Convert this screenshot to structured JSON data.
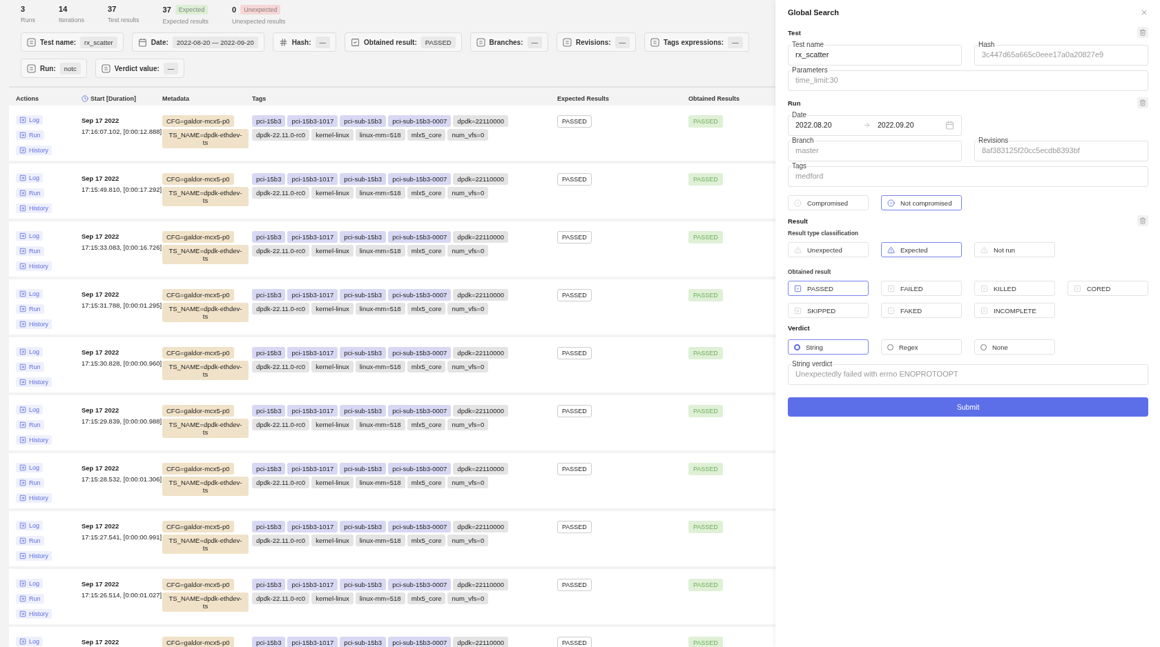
{
  "stats": [
    {
      "value": "3",
      "label": "Runs"
    },
    {
      "value": "14",
      "label": "Iterations"
    },
    {
      "value": "37",
      "label": "Test results"
    },
    {
      "value": "37",
      "label": "Expected results",
      "badge": "Expected",
      "color": "#dcefd6"
    },
    {
      "value": "0",
      "label": "Unexpected results",
      "badge": "Unexpected",
      "color": "#f6d6d6"
    }
  ],
  "filters": [
    {
      "kind": "text",
      "label": "Test name:",
      "value": "rx_scatter"
    },
    {
      "kind": "date",
      "label": "Date:",
      "value": "2022-08-20 — 2022-09-20"
    },
    {
      "kind": "hash",
      "label": "Hash:",
      "value": "—"
    },
    {
      "kind": "check",
      "label": "Obtained result:",
      "value": "PASSED"
    },
    {
      "kind": "text",
      "label": "Branches:",
      "value": "—"
    },
    {
      "kind": "text",
      "label": "Revisions:",
      "value": "—"
    },
    {
      "kind": "text",
      "label": "Tags expressions:",
      "value": "—"
    },
    {
      "kind": "text",
      "label": "Run:",
      "value": "notc"
    },
    {
      "kind": "text",
      "label": "Verdict value:",
      "value": "—"
    }
  ],
  "table": {
    "columns": [
      "Actions",
      "Start [Duration]",
      "Metadata",
      "Tags",
      "Expected Results",
      "Obtained Results"
    ],
    "rows": [
      {
        "actions": [
          "Log",
          "Run",
          "History"
        ],
        "date": "Sep 17 2022",
        "time": "17:16:07.102, [0:00:12.888]",
        "metadata": [
          "CFG=galdor-mcx5-p0",
          "TS_NAME=dpdk-ethdev-ts"
        ],
        "tags": [
          [
            {
              "text": "pci-15b3",
              "color": "#d8d8f4"
            },
            {
              "text": "pci-15b3-1017",
              "color": "#d8d8f4"
            },
            {
              "text": "pci-sub-15b3",
              "color": "#d8d8f4"
            },
            {
              "text": "pci-sub-15b3-0007",
              "color": "#d8d8f4"
            },
            {
              "text": "dpdk=22110000",
              "color": "#e4e4e4"
            }
          ],
          [
            {
              "text": "dpdk-22.11.0-rc0",
              "color": "#e4e4e4"
            },
            {
              "text": "kernel-linux",
              "color": "#e4e4e4"
            },
            {
              "text": "linux-mm=518",
              "color": "#e4e4e4"
            },
            {
              "text": "mlx5_core",
              "color": "#e4e4e4"
            },
            {
              "text": "num_vfs=0",
              "color": "#e4e4e4"
            }
          ]
        ],
        "expected": "PASSED",
        "obtained": "PASSED"
      },
      {
        "actions": [
          "Log",
          "Run",
          "History"
        ],
        "date": "Sep 17 2022",
        "time": "17:15:49.810, [0:00:17.292]",
        "metadata": [
          "CFG=galdor-mcx5-p0",
          "TS_NAME=dpdk-ethdev-ts"
        ],
        "tags": [
          [
            {
              "text": "pci-15b3",
              "color": "#d8d8f4"
            },
            {
              "text": "pci-15b3-1017",
              "color": "#d8d8f4"
            },
            {
              "text": "pci-sub-15b3",
              "color": "#d8d8f4"
            },
            {
              "text": "pci-sub-15b3-0007",
              "color": "#d8d8f4"
            },
            {
              "text": "dpdk=22110000",
              "color": "#e4e4e4"
            }
          ],
          [
            {
              "text": "dpdk-22.11.0-rc0",
              "color": "#e4e4e4"
            },
            {
              "text": "kernel-linux",
              "color": "#e4e4e4"
            },
            {
              "text": "linux-mm=518",
              "color": "#e4e4e4"
            },
            {
              "text": "mlx5_core",
              "color": "#e4e4e4"
            },
            {
              "text": "num_vfs=0",
              "color": "#e4e4e4"
            }
          ]
        ],
        "expected": "PASSED",
        "obtained": "PASSED"
      },
      {
        "actions": [
          "Log",
          "Run",
          "History"
        ],
        "date": "Sep 17 2022",
        "time": "17:15:33.083, [0:00:16.726]",
        "metadata": [
          "CFG=galdor-mcx5-p0",
          "TS_NAME=dpdk-ethdev-ts"
        ],
        "tags": [
          [
            {
              "text": "pci-15b3",
              "color": "#d8d8f4"
            },
            {
              "text": "pci-15b3-1017",
              "color": "#d8d8f4"
            },
            {
              "text": "pci-sub-15b3",
              "color": "#d8d8f4"
            },
            {
              "text": "pci-sub-15b3-0007",
              "color": "#d8d8f4"
            },
            {
              "text": "dpdk=22110000",
              "color": "#e4e4e4"
            }
          ],
          [
            {
              "text": "dpdk-22.11.0-rc0",
              "color": "#e4e4e4"
            },
            {
              "text": "kernel-linux",
              "color": "#e4e4e4"
            },
            {
              "text": "linux-mm=518",
              "color": "#e4e4e4"
            },
            {
              "text": "mlx5_core",
              "color": "#e4e4e4"
            },
            {
              "text": "num_vfs=0",
              "color": "#e4e4e4"
            }
          ]
        ],
        "expected": "PASSED",
        "obtained": "PASSED"
      },
      {
        "actions": [
          "Log",
          "Run",
          "History"
        ],
        "date": "Sep 17 2022",
        "time": "17:15:31.788, [0:00:01.295]",
        "metadata": [
          "CFG=galdor-mcx5-p0",
          "TS_NAME=dpdk-ethdev-ts"
        ],
        "tags": [
          [
            {
              "text": "pci-15b3",
              "color": "#d8d8f4"
            },
            {
              "text": "pci-15b3-1017",
              "color": "#d8d8f4"
            },
            {
              "text": "pci-sub-15b3",
              "color": "#d8d8f4"
            },
            {
              "text": "pci-sub-15b3-0007",
              "color": "#d8d8f4"
            },
            {
              "text": "dpdk=22110000",
              "color": "#e4e4e4"
            }
          ],
          [
            {
              "text": "dpdk-22.11.0-rc0",
              "color": "#e4e4e4"
            },
            {
              "text": "kernel-linux",
              "color": "#e4e4e4"
            },
            {
              "text": "linux-mm=518",
              "color": "#e4e4e4"
            },
            {
              "text": "mlx5_core",
              "color": "#e4e4e4"
            },
            {
              "text": "num_vfs=0",
              "color": "#e4e4e4"
            }
          ]
        ],
        "expected": "PASSED",
        "obtained": "PASSED"
      },
      {
        "actions": [
          "Log",
          "Run",
          "History"
        ],
        "date": "Sep 17 2022",
        "time": "17:15:30.828, [0:00:00.960]",
        "metadata": [
          "CFG=galdor-mcx5-p0",
          "TS_NAME=dpdk-ethdev-ts"
        ],
        "tags": [
          [
            {
              "text": "pci-15b3",
              "color": "#d8d8f4"
            },
            {
              "text": "pci-15b3-1017",
              "color": "#d8d8f4"
            },
            {
              "text": "pci-sub-15b3",
              "color": "#d8d8f4"
            },
            {
              "text": "pci-sub-15b3-0007",
              "color": "#d8d8f4"
            },
            {
              "text": "dpdk=22110000",
              "color": "#e4e4e4"
            }
          ],
          [
            {
              "text": "dpdk-22.11.0-rc0",
              "color": "#e4e4e4"
            },
            {
              "text": "kernel-linux",
              "color": "#e4e4e4"
            },
            {
              "text": "linux-mm=518",
              "color": "#e4e4e4"
            },
            {
              "text": "mlx5_core",
              "color": "#e4e4e4"
            },
            {
              "text": "num_vfs=0",
              "color": "#e4e4e4"
            }
          ]
        ],
        "expected": "PASSED",
        "obtained": "PASSED"
      },
      {
        "actions": [
          "Log",
          "Run",
          "History"
        ],
        "date": "Sep 17 2022",
        "time": "17:15:29.839, [0:00:00.988]",
        "metadata": [
          "CFG=galdor-mcx5-p0",
          "TS_NAME=dpdk-ethdev-ts"
        ],
        "tags": [
          [
            {
              "text": "pci-15b3",
              "color": "#d8d8f4"
            },
            {
              "text": "pci-15b3-1017",
              "color": "#d8d8f4"
            },
            {
              "text": "pci-sub-15b3",
              "color": "#d8d8f4"
            },
            {
              "text": "pci-sub-15b3-0007",
              "color": "#d8d8f4"
            },
            {
              "text": "dpdk=22110000",
              "color": "#e4e4e4"
            }
          ],
          [
            {
              "text": "dpdk-22.11.0-rc0",
              "color": "#e4e4e4"
            },
            {
              "text": "kernel-linux",
              "color": "#e4e4e4"
            },
            {
              "text": "linux-mm=518",
              "color": "#e4e4e4"
            },
            {
              "text": "mlx5_core",
              "color": "#e4e4e4"
            },
            {
              "text": "num_vfs=0",
              "color": "#e4e4e4"
            }
          ]
        ],
        "expected": "PASSED",
        "obtained": "PASSED"
      },
      {
        "actions": [
          "Log",
          "Run",
          "History"
        ],
        "date": "Sep 17 2022",
        "time": "17:15:28.532, [0:00:01.306]",
        "metadata": [
          "CFG=galdor-mcx5-p0",
          "TS_NAME=dpdk-ethdev-ts"
        ],
        "tags": [
          [
            {
              "text": "pci-15b3",
              "color": "#d8d8f4"
            },
            {
              "text": "pci-15b3-1017",
              "color": "#d8d8f4"
            },
            {
              "text": "pci-sub-15b3",
              "color": "#d8d8f4"
            },
            {
              "text": "pci-sub-15b3-0007",
              "color": "#d8d8f4"
            },
            {
              "text": "dpdk=22110000",
              "color": "#e4e4e4"
            }
          ],
          [
            {
              "text": "dpdk-22.11.0-rc0",
              "color": "#e4e4e4"
            },
            {
              "text": "kernel-linux",
              "color": "#e4e4e4"
            },
            {
              "text": "linux-mm=518",
              "color": "#e4e4e4"
            },
            {
              "text": "mlx5_core",
              "color": "#e4e4e4"
            },
            {
              "text": "num_vfs=0",
              "color": "#e4e4e4"
            }
          ]
        ],
        "expected": "PASSED",
        "obtained": "PASSED"
      },
      {
        "actions": [
          "Log",
          "Run",
          "History"
        ],
        "date": "Sep 17 2022",
        "time": "17:15:27.541, [0:00:00.991]",
        "metadata": [
          "CFG=galdor-mcx5-p0",
          "TS_NAME=dpdk-ethdev-ts"
        ],
        "tags": [
          [
            {
              "text": "pci-15b3",
              "color": "#d8d8f4"
            },
            {
              "text": "pci-15b3-1017",
              "color": "#d8d8f4"
            },
            {
              "text": "pci-sub-15b3",
              "color": "#d8d8f4"
            },
            {
              "text": "pci-sub-15b3-0007",
              "color": "#d8d8f4"
            },
            {
              "text": "dpdk=22110000",
              "color": "#e4e4e4"
            }
          ],
          [
            {
              "text": "dpdk-22.11.0-rc0",
              "color": "#e4e4e4"
            },
            {
              "text": "kernel-linux",
              "color": "#e4e4e4"
            },
            {
              "text": "linux-mm=518",
              "color": "#e4e4e4"
            },
            {
              "text": "mlx5_core",
              "color": "#e4e4e4"
            },
            {
              "text": "num_vfs=0",
              "color": "#e4e4e4"
            }
          ]
        ],
        "expected": "PASSED",
        "obtained": "PASSED"
      },
      {
        "actions": [
          "Log",
          "Run",
          "History"
        ],
        "date": "Sep 17 2022",
        "time": "17:15:26.514, [0:00:01.027]",
        "metadata": [
          "CFG=galdor-mcx5-p0",
          "TS_NAME=dpdk-ethdev-ts"
        ],
        "tags": [
          [
            {
              "text": "pci-15b3",
              "color": "#d8d8f4"
            },
            {
              "text": "pci-15b3-1017",
              "color": "#d8d8f4"
            },
            {
              "text": "pci-sub-15b3",
              "color": "#d8d8f4"
            },
            {
              "text": "pci-sub-15b3-0007",
              "color": "#d8d8f4"
            },
            {
              "text": "dpdk=22110000",
              "color": "#e4e4e4"
            }
          ],
          [
            {
              "text": "dpdk-22.11.0-rc0",
              "color": "#e4e4e4"
            },
            {
              "text": "kernel-linux",
              "color": "#e4e4e4"
            },
            {
              "text": "linux-mm=518",
              "color": "#e4e4e4"
            },
            {
              "text": "mlx5_core",
              "color": "#e4e4e4"
            },
            {
              "text": "num_vfs=0",
              "color": "#e4e4e4"
            }
          ]
        ],
        "expected": "PASSED",
        "obtained": "PASSED"
      },
      {
        "actions": [
          "Log"
        ],
        "date": "Sep 17 2022",
        "metadata": [
          "CFG=galdor-mcx5-p0"
        ],
        "tags": [
          [
            {
              "text": "pci-15b3",
              "color": "#d8d8f4"
            },
            {
              "text": "pci-15b3-1017",
              "color": "#d8d8f4"
            },
            {
              "text": "pci-sub-15b3",
              "color": "#d8d8f4"
            },
            {
              "text": "pci-sub-15b3-0007",
              "color": "#d8d8f4"
            },
            {
              "text": "dpdk=22110000",
              "color": "#e4e4e4"
            }
          ]
        ],
        "expected": "PASSED",
        "obtained": "PASSED"
      }
    ]
  },
  "search": {
    "title": "Global Search",
    "test": {
      "title": "Test",
      "test_name": {
        "label": "Test name",
        "value": "rx_scatter"
      },
      "hash": {
        "label": "Hash",
        "placeholder": "3c447d65a665c0eee17a0a20827e9"
      },
      "parameters": {
        "label": "Parameters",
        "placeholder": "time_limit:30"
      }
    },
    "run": {
      "title": "Run",
      "date": {
        "label": "Date",
        "from": "2022.08.20",
        "to": "2022.09.20"
      },
      "branch": {
        "label": "Branch",
        "placeholder": "master"
      },
      "revisions": {
        "label": "Revisions",
        "placeholder": "8af383125f20cc5ecdb8393bf"
      },
      "tags": {
        "label": "Tags",
        "placeholder": "medford"
      },
      "compromise": [
        {
          "label": "Compromised",
          "selected": false
        },
        {
          "label": "Not compromised",
          "selected": true
        }
      ]
    },
    "result": {
      "title": "Result",
      "classification_label": "Result type classification",
      "classification": [
        {
          "label": "Unexpected",
          "selected": false
        },
        {
          "label": "Expected",
          "selected": true
        },
        {
          "label": "Not run",
          "selected": false
        }
      ],
      "obtained_label": "Obtained result",
      "obtained": [
        {
          "label": "PASSED",
          "selected": true
        },
        {
          "label": "FAILED",
          "selected": false
        },
        {
          "label": "KILLED",
          "selected": false
        },
        {
          "label": "CORED",
          "selected": false
        },
        {
          "label": "SKIPPED",
          "selected": false
        },
        {
          "label": "FAKED",
          "selected": false
        },
        {
          "label": "INCOMPLETE",
          "selected": false
        }
      ],
      "verdict_label": "Verdict",
      "verdict": [
        {
          "label": "String",
          "selected": true
        },
        {
          "label": "Regex",
          "selected": false
        },
        {
          "label": "None",
          "selected": false
        }
      ],
      "string_verdict": {
        "label": "String verdict",
        "placeholder": "Unexpectedly failed with errno ENOPROTOOPT"
      }
    },
    "submit": "Submit"
  }
}
